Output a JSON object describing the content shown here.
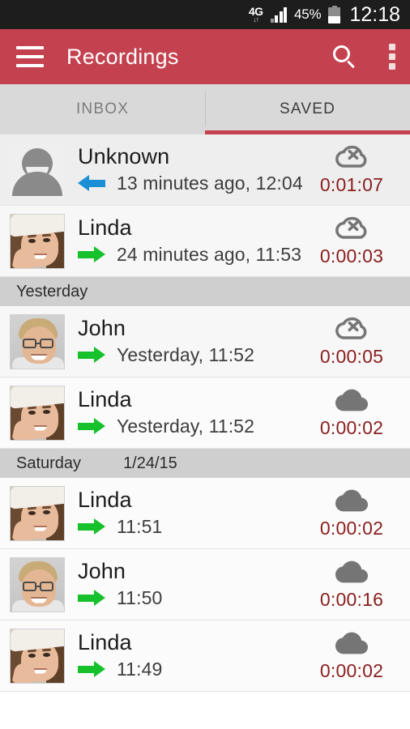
{
  "statusbar": {
    "network_label": "4G",
    "network_arrows": "↓↑",
    "battery_pct": "45%",
    "battery_level": 45,
    "clock": "12:18"
  },
  "appbar": {
    "menu_icon": "hamburger-icon",
    "title": "Recordings",
    "search_icon": "search-icon",
    "overflow_icon": "overflow-menu-icon",
    "background": "#c4424f"
  },
  "tabs": {
    "items": [
      {
        "label": "INBOX",
        "active": false
      },
      {
        "label": "SAVED",
        "active": true
      }
    ],
    "indicator_color": "#c4424f"
  },
  "colors": {
    "accent": "#c4424f",
    "duration_text": "#8b1d1d",
    "arrow_outgoing": "#16c12b",
    "arrow_incoming": "#1a8fd6",
    "cloud": "#757575"
  },
  "list": [
    {
      "type": "row",
      "avatar": "avatar-unknown-silhouette",
      "name": "Unknown",
      "direction": "incoming",
      "direction_icon": "arrow-incoming-icon",
      "time": "13 minutes ago, 12:04",
      "cloud_icon": "cloud-off-icon",
      "duration": "0:01:07"
    },
    {
      "type": "row",
      "avatar": "avatar-linda-photo",
      "name": "Linda",
      "direction": "outgoing",
      "direction_icon": "arrow-outgoing-icon",
      "time": "24 minutes ago, 11:53",
      "cloud_icon": "cloud-off-icon",
      "duration": "0:00:03"
    },
    {
      "type": "header",
      "title": "Yesterday",
      "date": ""
    },
    {
      "type": "row",
      "avatar": "avatar-john-photo",
      "name": "John",
      "direction": "outgoing",
      "direction_icon": "arrow-outgoing-icon",
      "time": "Yesterday, 11:52",
      "cloud_icon": "cloud-off-icon",
      "duration": "0:00:05"
    },
    {
      "type": "row",
      "avatar": "avatar-linda-photo",
      "name": "Linda",
      "direction": "outgoing",
      "direction_icon": "arrow-outgoing-icon",
      "time": "Yesterday, 11:52",
      "cloud_icon": "cloud-uploaded-icon",
      "duration": "0:00:02"
    },
    {
      "type": "header",
      "title": "Saturday",
      "date": "1/24/15"
    },
    {
      "type": "row",
      "avatar": "avatar-linda-photo",
      "name": "Linda",
      "direction": "outgoing",
      "direction_icon": "arrow-outgoing-icon",
      "time": "11:51",
      "cloud_icon": "cloud-uploaded-icon",
      "duration": "0:00:02"
    },
    {
      "type": "row",
      "avatar": "avatar-john-photo",
      "name": "John",
      "direction": "outgoing",
      "direction_icon": "arrow-outgoing-icon",
      "time": "11:50",
      "cloud_icon": "cloud-uploaded-icon",
      "duration": "0:00:16"
    },
    {
      "type": "row",
      "avatar": "avatar-linda-photo",
      "name": "Linda",
      "direction": "outgoing",
      "direction_icon": "arrow-outgoing-icon",
      "time": "11:49",
      "cloud_icon": "cloud-uploaded-icon",
      "duration": "0:00:02"
    }
  ]
}
